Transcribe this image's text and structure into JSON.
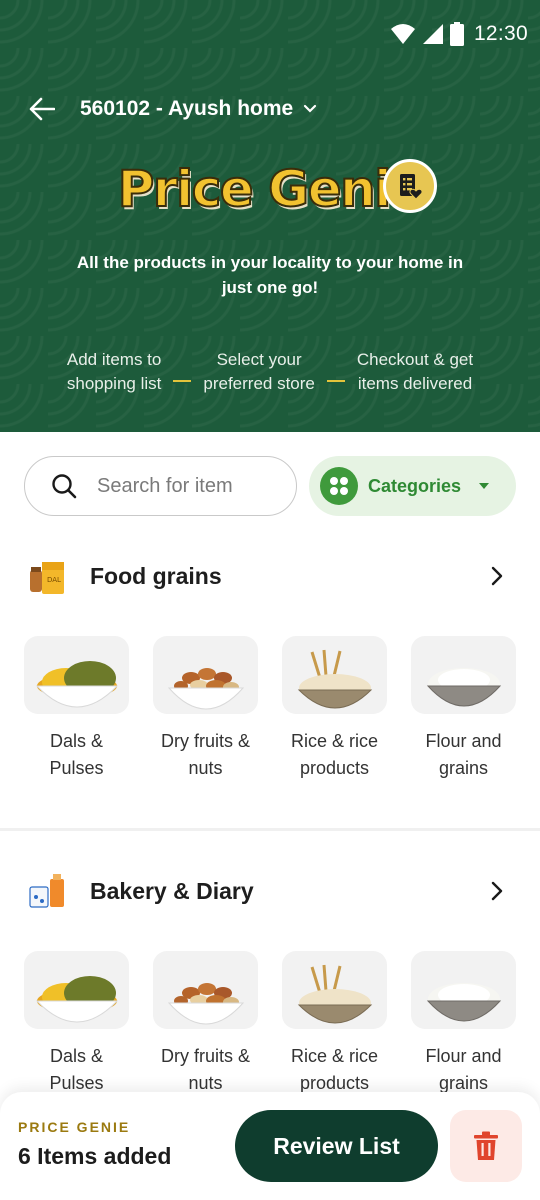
{
  "status_bar": {
    "time": "12:30",
    "icons": [
      "wifi-icon",
      "signal-icon",
      "battery-icon"
    ]
  },
  "header": {
    "location": "560102 - Ayush home"
  },
  "brand": {
    "title": "Price Genie",
    "tagline": "All the products in your locality to your home in just one go!"
  },
  "steps": [
    {
      "line1": "Add items to",
      "line2": "shopping list"
    },
    {
      "line1": "Select your",
      "line2": "preferred store"
    },
    {
      "line1": "Checkout & get",
      "line2": "items delivered"
    }
  ],
  "search": {
    "placeholder": "Search for item"
  },
  "categories_button": {
    "label": "Categories"
  },
  "sections": [
    {
      "title": "Food grains",
      "items": [
        {
          "line1": "Dals &",
          "line2": "Pulses",
          "icon": "dals-pulses-image"
        },
        {
          "line1": "Dry fruits &",
          "line2": "nuts",
          "icon": "dry-fruits-image"
        },
        {
          "line1": "Rice & rice",
          "line2": "products",
          "icon": "rice-products-image"
        },
        {
          "line1": "Flour and",
          "line2": "grains",
          "icon": "flour-grains-image"
        }
      ]
    },
    {
      "title": "Bakery & Diary",
      "items": [
        {
          "line1": "Dals &",
          "line2": "Pulses",
          "icon": "dals-pulses-image"
        },
        {
          "line1": "Dry fruits &",
          "line2": "nuts",
          "icon": "dry-fruits-image"
        },
        {
          "line1": "Rice & rice",
          "line2": "products",
          "icon": "rice-products-image"
        },
        {
          "line1": "Flour and",
          "line2": "grains",
          "icon": "flour-grains-image"
        }
      ]
    }
  ],
  "bottom_bar": {
    "label": "PRICE GENIE",
    "count_text": "6 Items added",
    "review_label": "Review List"
  },
  "colors": {
    "hero_green": "#1d5b3b",
    "brand_gold": "#f2c230",
    "accent_green": "#2f8a34",
    "dark_green_button": "#0f3d2e",
    "trash_red": "#e0452d"
  }
}
